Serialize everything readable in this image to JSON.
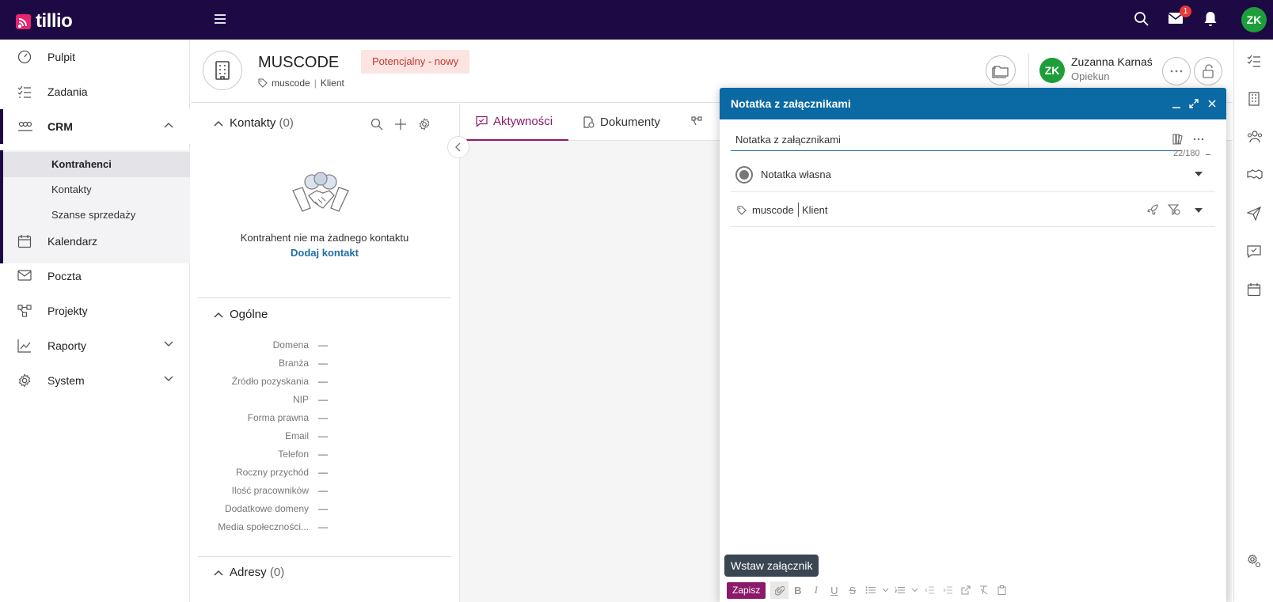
{
  "topbar": {
    "logo_text": "tillio",
    "mail_badge": "1",
    "avatar_initials": "ZK",
    "icons": [
      "menu-icon",
      "search-icon",
      "mail-icon",
      "bell-icon"
    ]
  },
  "sidebar": {
    "items": [
      {
        "label": "Pulpit",
        "icon": "gauge-icon"
      },
      {
        "label": "Zadania",
        "icon": "tasks-icon"
      },
      {
        "label": "CRM",
        "icon": "crm-icon"
      },
      {
        "label": "Kalendarz",
        "icon": "calendar-icon"
      },
      {
        "label": "Poczta",
        "icon": "mail-icon"
      },
      {
        "label": "Projekty",
        "icon": "projects-icon"
      },
      {
        "label": "Raporty",
        "icon": "chart-icon"
      },
      {
        "label": "System",
        "icon": "gear-icon"
      }
    ],
    "crm_sub": [
      {
        "label": "Kontrahenci",
        "active": true
      },
      {
        "label": "Kontakty",
        "active": false
      },
      {
        "label": "Szanse sprzedaży",
        "active": false
      }
    ]
  },
  "header": {
    "title": "MUSCODE",
    "tag_name": "muscode",
    "tag_type": "Klient",
    "status": "Potencjalny - nowy",
    "owner_initials": "ZK",
    "owner_name": "Zuzanna Karnaś",
    "owner_role": "Opiekun"
  },
  "contacts": {
    "title": "Kontakty",
    "count": "(0)",
    "empty_text": "Kontrahent nie ma żadnego kontaktu",
    "add_link": "Dodaj kontakt"
  },
  "general": {
    "title": "Ogólne",
    "fields": [
      {
        "label": "Domena",
        "value": "—"
      },
      {
        "label": "Branża",
        "value": "—"
      },
      {
        "label": "Źródło pozyskania",
        "value": "—"
      },
      {
        "label": "NIP",
        "value": "—"
      },
      {
        "label": "Forma prawna",
        "value": "—"
      },
      {
        "label": "Email",
        "value": "—"
      },
      {
        "label": "Telefon",
        "value": "—"
      },
      {
        "label": "Roczny przychód",
        "value": "—"
      },
      {
        "label": "Ilość pracowników",
        "value": "—"
      },
      {
        "label": "Dodatkowe domeny",
        "value": "—"
      },
      {
        "label": "Media społeczności...",
        "value": "—"
      }
    ]
  },
  "addresses": {
    "title": "Adresy",
    "count": "(0)"
  },
  "tabs": [
    {
      "label": "Aktywności",
      "active": true
    },
    {
      "label": "Dokumenty",
      "active": false
    }
  ],
  "note_modal": {
    "title": "Notatka z załącznikami",
    "title_value": "Notatka z załącznikami",
    "counter": "22/180",
    "type": "Notatka własna",
    "tag_name": "muscode",
    "tag_type": "Klient",
    "tooltip": "Wstaw załącznik",
    "save_label": "Zapisz",
    "toolbar_icons": [
      "attach-icon",
      "bold-icon",
      "italic-icon",
      "underline-icon",
      "strikethrough-icon",
      "bullet-list-icon",
      "numbered-list-icon",
      "outdent-icon",
      "indent-icon",
      "link-icon",
      "clear-format-icon",
      "paste-icon"
    ]
  },
  "colors": {
    "topbar": "#1d0a45",
    "accent": "#8b1a6b",
    "modal_header": "#0b6aa3",
    "status_bg": "#fbe4e2",
    "status_text": "#c0392b",
    "avatar": "#1e9e3a",
    "logo": "#e8236f"
  }
}
